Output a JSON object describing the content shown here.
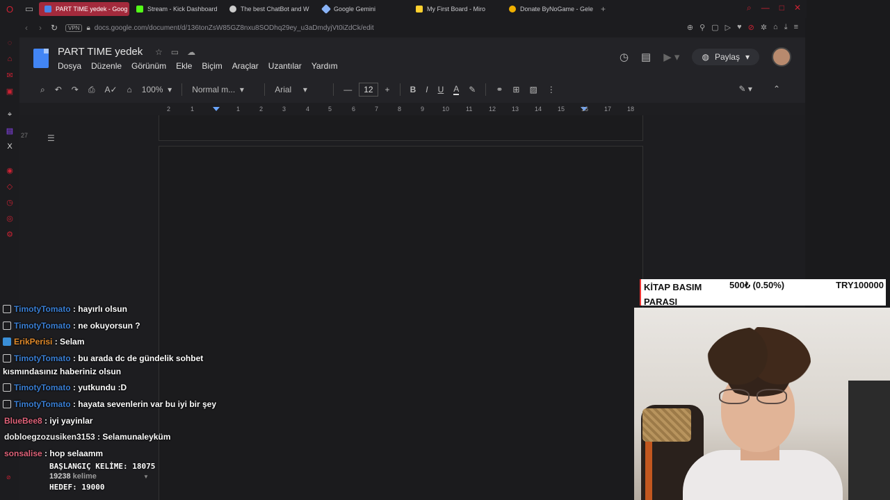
{
  "browser": {
    "tabs": [
      {
        "label": "PART TIME yedek - Goog",
        "active": true,
        "color": "#4a86e8"
      },
      {
        "label": "Stream - Kick Dashboard",
        "active": false,
        "color": "#53fc18"
      },
      {
        "label": "The best ChatBot and W",
        "active": false,
        "color": "#cccccc"
      },
      {
        "label": "Google Gemini",
        "active": false,
        "color": "#8ab4f8"
      },
      {
        "label": "My First Board - Miro",
        "active": false,
        "color": "#ffd02f"
      },
      {
        "label": "Donate ByNoGame - Gele",
        "active": false,
        "color": "#f0b000"
      }
    ],
    "url": "docs.google.com/document/d/136tonZsW85GZ8nxu8SODhq29ey_u3aDmdyjVt0iZdCk/edit",
    "vpn_label": "VPN"
  },
  "docs": {
    "title": "PART TIME  yedek",
    "menu": [
      "Dosya",
      "Düzenle",
      "Görünüm",
      "Ekle",
      "Biçim",
      "Araçlar",
      "Uzantılar",
      "Yardım"
    ],
    "share_label": "Paylaş",
    "toolbar": {
      "zoom": "100%",
      "style": "Normal m...",
      "font": "Arial",
      "font_size": "12"
    },
    "ruler_ticks": [
      "2",
      "1",
      "1",
      "2",
      "3",
      "4",
      "5",
      "6",
      "7",
      "8",
      "9",
      "10",
      "11",
      "12",
      "13",
      "14",
      "15",
      "16",
      "17",
      "18"
    ],
    "vertical_ruler": "27"
  },
  "overlay": {
    "counter": {
      "label": "KİTAP BASIM PARASI",
      "value": "500₺ (0.50%)",
      "goal": "TRY100000"
    },
    "chat": [
      {
        "user": "TimotyTomato",
        "msg": ": hayırlı olsun",
        "color": "blue",
        "badge": true
      },
      {
        "user": "TimotyTomato",
        "msg": ": ne okuyorsun ?",
        "color": "blue",
        "badge": true
      },
      {
        "user": "ErikPerisi",
        "msg": ": Selam",
        "color": "orange",
        "badge": true
      },
      {
        "user": "TimotyTomato",
        "msg": ": bu arada dc de gündelik sohbet",
        "color": "blue",
        "badge": true
      },
      {
        "user": "",
        "msg": "kısmındasınız haberiniz olsun",
        "color": "white",
        "badge": false
      },
      {
        "user": "TimotyTomato",
        "msg": ": yutkundu :D",
        "color": "blue",
        "badge": true
      },
      {
        "user": "TimotyTomato",
        "msg": ": hayata sevenlerin var bu iyi bir şey",
        "color": "blue",
        "badge": true
      },
      {
        "user": "BlueBee8",
        "msg": ": iyi yayinlar",
        "color": "pink",
        "badge": false
      },
      {
        "user": "dobloegzozusiken3153",
        "msg": ": Selamunaleyküm",
        "color": "white",
        "badge": false
      },
      {
        "user": "sonsalise",
        "msg": ": hop selaamm",
        "color": "pink",
        "badge": false
      }
    ],
    "word_start": "BAŞLANGIÇ KELİME: 18075",
    "word_count_num": "19238",
    "word_count_label": "kelime",
    "word_goal": "HEDEF: 19000"
  }
}
